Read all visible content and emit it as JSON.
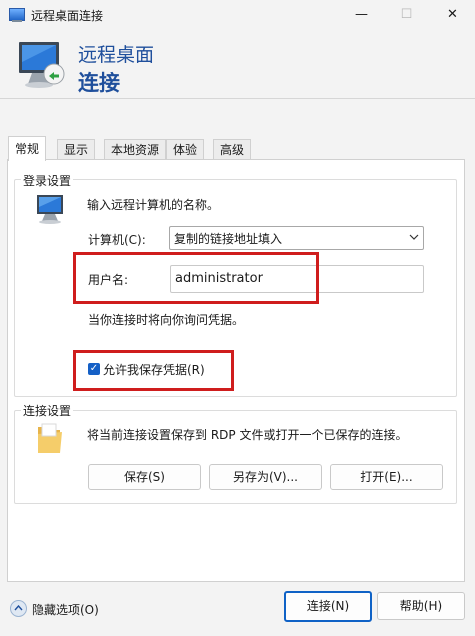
{
  "window": {
    "title": "远程桌面连接",
    "controls": {
      "minimize": "—",
      "maximize": "☐",
      "close": "✕"
    }
  },
  "header": {
    "line1": "远程桌面",
    "line2": "连接"
  },
  "tabs": [
    {
      "label": "常规"
    },
    {
      "label": "显示"
    },
    {
      "label": "本地资源"
    },
    {
      "label": "体验"
    },
    {
      "label": "高级"
    }
  ],
  "login": {
    "group_label": "登录设置",
    "instruction": "输入远程计算机的名称。",
    "computer_label": "计算机(C):",
    "computer_value": "复制的链接地址填入",
    "username_label": "用户名:",
    "username_value": "administrator",
    "note": "当你连接时将向你询问凭据。",
    "allow_save_label": "允许我保存凭据(R)"
  },
  "connection": {
    "group_label": "连接设置",
    "description": "将当前连接设置保存到 RDP 文件或打开一个已保存的连接。",
    "save_button": "保存(S)",
    "save_as_button": "另存为(V)...",
    "open_button": "打开(E)..."
  },
  "footer": {
    "hide_options": "隐藏选项(O)",
    "connect_button": "连接(N)",
    "help_button": "帮助(H)"
  }
}
